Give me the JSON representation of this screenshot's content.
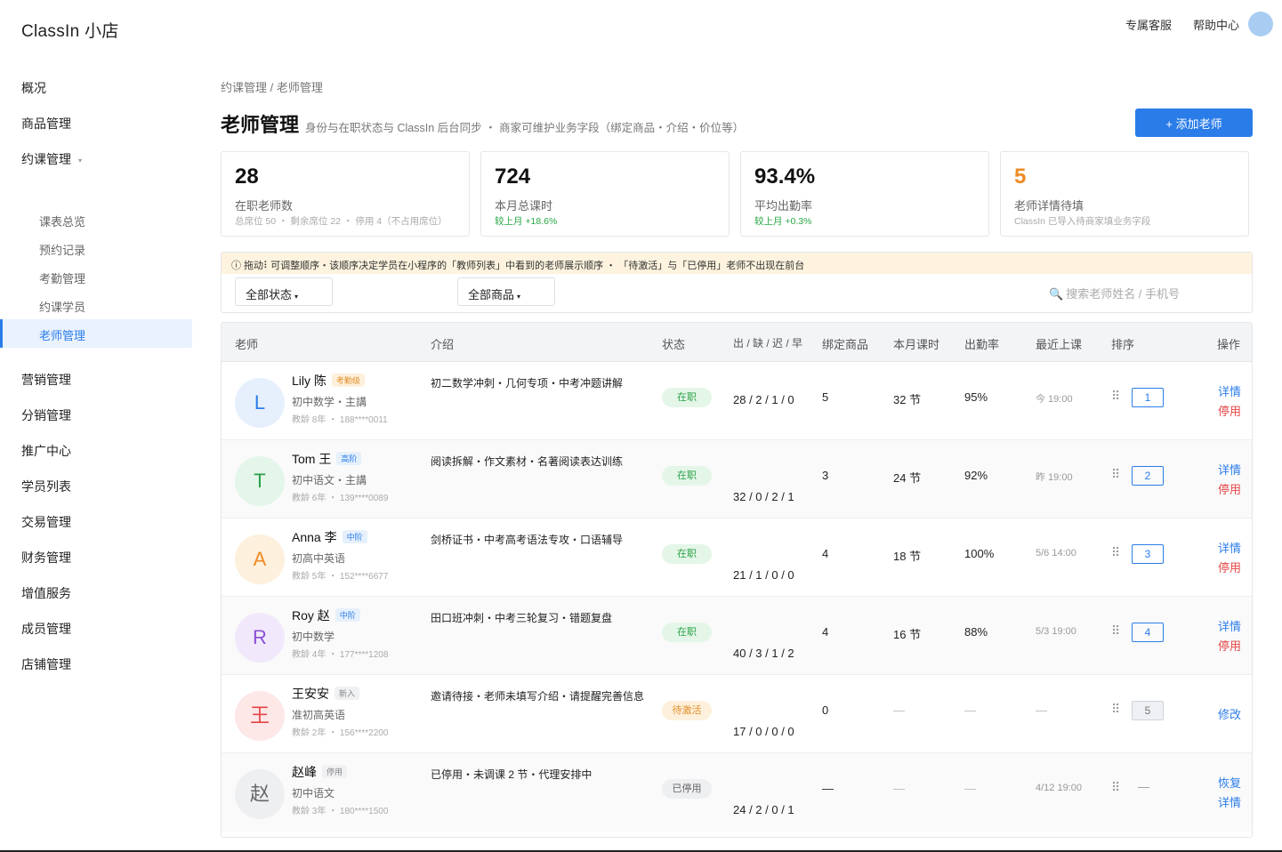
{
  "app": {
    "brand": "ClassIn 小店",
    "service_link": "专属客服",
    "help_link": "帮助中心"
  },
  "sidebar": {
    "items": [
      {
        "label": "概况"
      },
      {
        "label": "商品管理"
      },
      {
        "label": "约课管理"
      },
      {
        "label": "营销管理"
      },
      {
        "label": "分销管理"
      },
      {
        "label": "推广中心"
      },
      {
        "label": "学员列表"
      },
      {
        "label": "交易管理"
      },
      {
        "label": "财务管理"
      },
      {
        "label": "增值服务"
      },
      {
        "label": "成员管理"
      },
      {
        "label": "店铺管理"
      }
    ],
    "sub_items": [
      {
        "label": "课表总览"
      },
      {
        "label": "预约记录"
      },
      {
        "label": "考勤管理"
      },
      {
        "label": "约课学员"
      },
      {
        "label": "老师管理"
      }
    ]
  },
  "breadcrumb": "约课管理 / 老师管理",
  "page": {
    "title": "老师管理",
    "subtitle": "身份与在职状态与 ClassIn 后台同步 ・ 商家可维护业务字段（绑定商品・介绍・价位等）",
    "add_button": "+ 添加老师"
  },
  "stats": [
    {
      "value": "28",
      "label": "在职老师数",
      "note": "总席位 50 ・ 剩余席位 22 ・ 停用 4（不占用席位）"
    },
    {
      "value": "724",
      "label": "本月总课时",
      "note": "较上月 +18.6%"
    },
    {
      "value": "93.4%",
      "label": "平均出勤率",
      "note": "较上月 +0.3%"
    },
    {
      "value": "5",
      "label": "老师详情待填",
      "note": "ClassIn 已导入待商家填业务字段"
    }
  ],
  "filters": {
    "tip": "ⓘ 拖动⠇可调整顺序・该顺序决定学员在小程序的「教师列表」中看到的老师展示顺序 ・ 「待激活」与「已停用」老师不出现在前台",
    "status_select": "全部状态",
    "product_select": "全部商品",
    "search_placeholder": "搜索老师姓名 / 手机号"
  },
  "table": {
    "headers": {
      "teacher": "老师",
      "intro": "介绍",
      "status": "状态",
      "attendance": "出 / 缺 / 迟 / 早",
      "bound": "绑定商品",
      "hours": "本月课时",
      "rate": "出勤率",
      "recent": "最近上课",
      "order": "排序",
      "ops": "操作"
    },
    "rows": [
      {
        "initial": "L",
        "name": "Lily 陈",
        "badge": "考勤级",
        "subject": "初中数学・主講",
        "meta": "教龄 8年 ・ 188****0011",
        "intro": "初二数学冲刺・几何专项・中考冲题讲解",
        "status": "在职",
        "attendance": "28 / 2 / 1 / 0",
        "bound": "5",
        "hours": "32 节",
        "rate": "95%",
        "recent": "今 19:00",
        "order": "1",
        "op1": "详情",
        "op2": "停用"
      },
      {
        "initial": "T",
        "name": "Tom 王",
        "badge": "高阶",
        "subject": "初中语文・主講",
        "meta": "教龄 6年 ・ 139****0089",
        "intro": "阅读拆解・作文素材・名著阅读表达训练",
        "status": "在职",
        "attendance": "32 / 0 / 2 / 1",
        "bound": "3",
        "hours": "24 节",
        "rate": "92%",
        "recent": "昨 19:00",
        "order": "2",
        "op1": "详情",
        "op2": "停用"
      },
      {
        "initial": "A",
        "name": "Anna 李",
        "badge": "中阶",
        "subject": "初高中英语",
        "meta": "教龄 5年 ・ 152****6677",
        "intro": "剑桥证书・中考高考语法专攻・口语辅导",
        "status": "在职",
        "attendance": "21 / 1 / 0 / 0",
        "bound": "4",
        "hours": "18 节",
        "rate": "100%",
        "recent": "5/6 14:00",
        "order": "3",
        "op1": "详情",
        "op2": "停用"
      },
      {
        "initial": "R",
        "name": "Roy 赵",
        "badge": "中阶",
        "subject": "初中数学",
        "meta": "教龄 4年 ・ 177****1208",
        "intro": "田口班冲刺・中考三轮复习・错题复盘",
        "status": "在职",
        "attendance": "40 / 3 / 1 / 2",
        "bound": "4",
        "hours": "16 节",
        "rate": "88%",
        "recent": "5/3 19:00",
        "order": "4",
        "op1": "详情",
        "op2": "停用"
      },
      {
        "initial": "王",
        "name": "王安安",
        "badge": "新入",
        "subject": "准初高英语",
        "meta": "教龄 2年 ・ 156****2200",
        "intro": "邀请待接・老师未填写介绍・请提醒完善信息",
        "status": "待激活",
        "attendance": "17 / 0 / 0 / 0",
        "bound": "0",
        "hours": "—",
        "rate": "—",
        "recent": "—",
        "order": "5",
        "op1": "修改"
      },
      {
        "initial": "赵",
        "name": "赵峰",
        "badge": "停用",
        "subject": "初中语文",
        "meta": "教龄 3年 ・ 180****1500",
        "intro": "已停用・未调课 2 节・代理安排中",
        "status": "已停用",
        "attendance": "24 / 2 / 0 / 1",
        "bound": "—",
        "hours": "—",
        "rate": "—",
        "recent": "4/12 19:00",
        "order": "—",
        "op1": "恢复",
        "op2": "详情"
      }
    ]
  },
  "colors": {
    "accent": "#2b7de9",
    "success": "#28a745",
    "warning": "#f08a24",
    "danger": "#e64545"
  }
}
